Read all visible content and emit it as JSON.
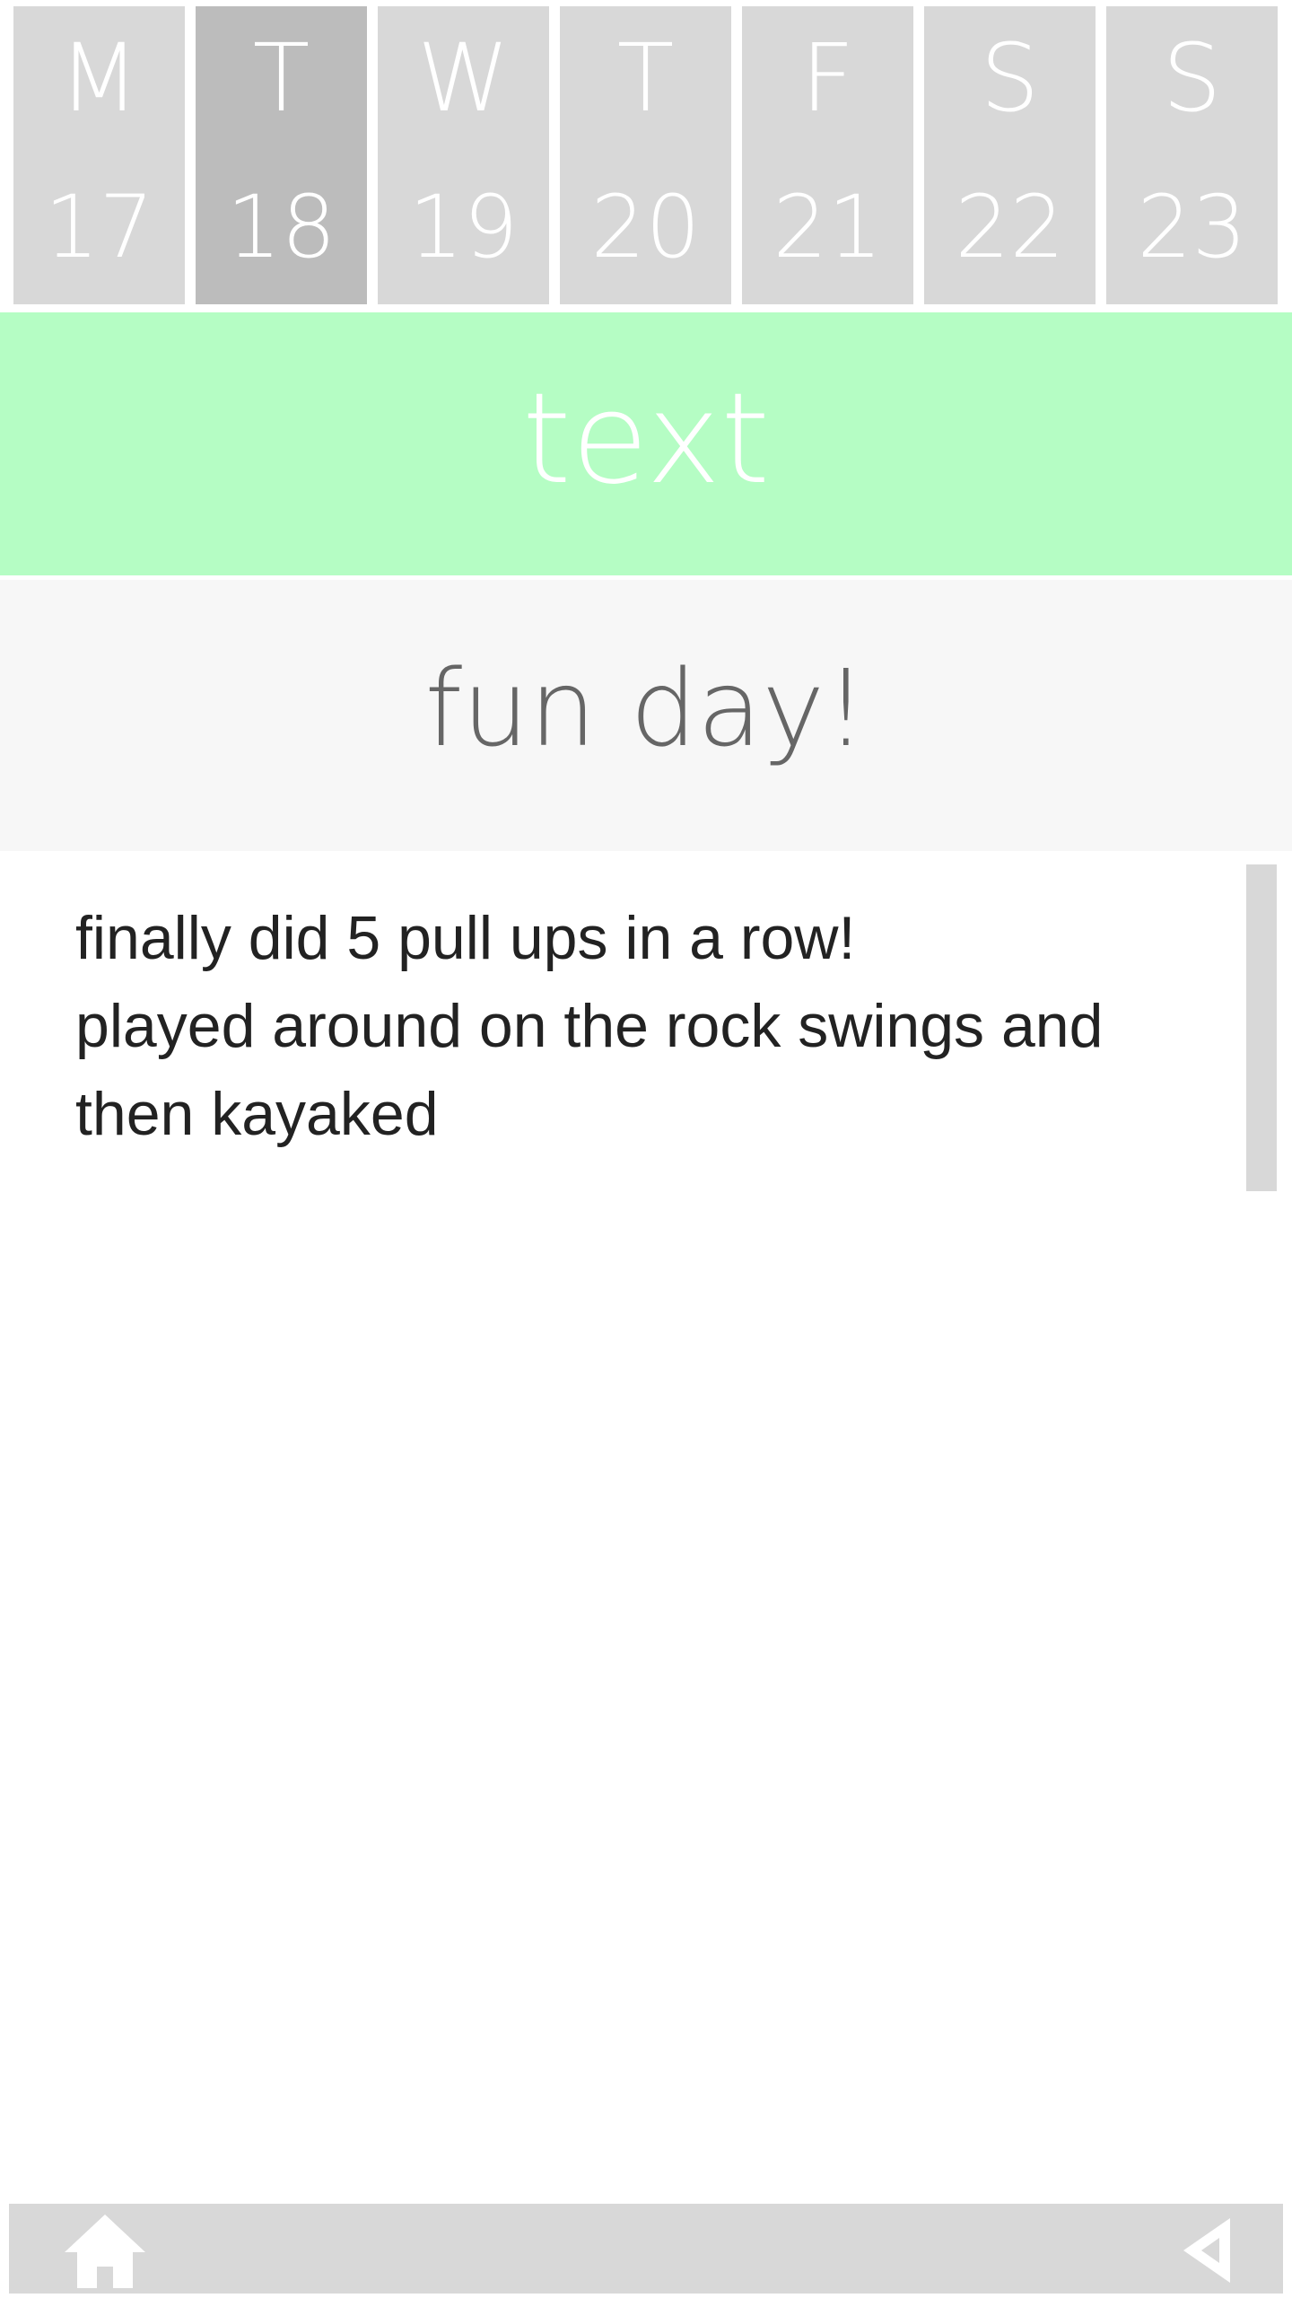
{
  "week": {
    "days": [
      {
        "letter": "M",
        "number": "17"
      },
      {
        "letter": "T",
        "number": "18",
        "selected": true
      },
      {
        "letter": "W",
        "number": "19"
      },
      {
        "letter": "T",
        "number": "20"
      },
      {
        "letter": "F",
        "number": "21"
      },
      {
        "letter": "S",
        "number": "22"
      },
      {
        "letter": "S",
        "number": "23"
      }
    ]
  },
  "mode": {
    "label": "text"
  },
  "entry": {
    "title": "fun day!",
    "lines": [
      "finally did 5 pull ups in a row!",
      "played around on the rock swings and",
      "then kayaked"
    ]
  },
  "nav": {
    "home_icon": "home-icon",
    "back_icon": "back-triangle-icon"
  },
  "colors": {
    "tile": "#d8d8d8",
    "tile_selected": "#bcbcbc",
    "mode_banner": "#b5fdc4",
    "title_panel": "#f7f7f7",
    "title_text": "#666666",
    "body_text": "#222222"
  }
}
